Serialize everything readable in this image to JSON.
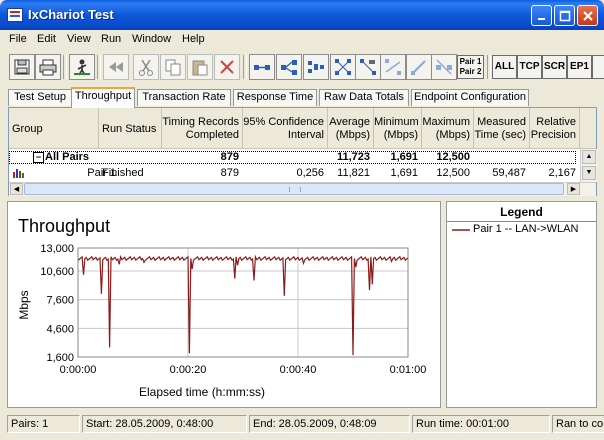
{
  "window": {
    "title": "IxChariot Test"
  },
  "menu": [
    "File",
    "Edit",
    "View",
    "Run",
    "Window",
    "Help"
  ],
  "toolbar": {
    "pair_label_1": "Pair 1",
    "pair_label_2": "Pair 2",
    "all": "ALL",
    "tcp": "TCP",
    "scr": "SCR",
    "ep1": "EP1"
  },
  "tabs": [
    "Test Setup",
    "Throughput",
    "Transaction Rate",
    "Response Time",
    "Raw Data Totals",
    "Endpoint Configuration"
  ],
  "active_tab": "Throughput",
  "table": {
    "headers": [
      {
        "line1": "",
        "line2": "Group"
      },
      {
        "line1": "",
        "line2": "Run Status"
      },
      {
        "line1": "Timing Records",
        "line2": "Completed"
      },
      {
        "line1": "95% Confidence",
        "line2": "Interval"
      },
      {
        "line1": "Average",
        "line2": "(Mbps)"
      },
      {
        "line1": "Minimum",
        "line2": "(Mbps)"
      },
      {
        "line1": "Maximum",
        "line2": "(Mbps)"
      },
      {
        "line1": "Measured",
        "line2": "Time (sec)"
      },
      {
        "line1": "Relative",
        "line2": "Precision"
      }
    ],
    "summary": {
      "group": "All Pairs",
      "records": "879",
      "average": "11,723",
      "minimum": "1,691",
      "maximum": "12,500"
    },
    "rows": [
      {
        "group": "Pair 1",
        "status": "Finished",
        "records": "879",
        "confidence": "0,256",
        "average": "11,821",
        "minimum": "1,691",
        "maximum": "12,500",
        "measured": "59,487",
        "precision": "2,167"
      }
    ]
  },
  "chart": {
    "title": "Throughput",
    "colors": {
      "series": "#8b1a1a",
      "grid": "#c8c8c8"
    }
  },
  "chart_data": {
    "type": "line",
    "title": "Throughput",
    "xlabel": "Elapsed time (h:mm:ss)",
    "ylabel": "Mbps",
    "x_ticks": [
      "0:00:00",
      "0:00:20",
      "0:00:40",
      "0:01:00"
    ],
    "y_ticks": [
      "1,600",
      "4,600",
      "7,600",
      "10,600",
      "13,000"
    ],
    "xlim": [
      0,
      60
    ],
    "ylim": [
      1600,
      13000
    ],
    "series": [
      {
        "name": "Pair 1 -- LAN->WLAN",
        "baseline": 11900,
        "dips": [
          {
            "x": 1.0,
            "y": 10200
          },
          {
            "x": 4.2,
            "y": 8200
          },
          {
            "x": 5.7,
            "y": 2600
          },
          {
            "x": 7.5,
            "y": 11300
          },
          {
            "x": 12.0,
            "y": 11500
          },
          {
            "x": 20.2,
            "y": 2000
          },
          {
            "x": 20.8,
            "y": 10800
          },
          {
            "x": 28.5,
            "y": 9800
          },
          {
            "x": 29.0,
            "y": 11200
          },
          {
            "x": 32.0,
            "y": 9600
          },
          {
            "x": 37.5,
            "y": 8000
          },
          {
            "x": 41.0,
            "y": 11400
          },
          {
            "x": 50.0,
            "y": 1800
          },
          {
            "x": 50.5,
            "y": 11000
          },
          {
            "x": 53.0,
            "y": 8600
          },
          {
            "x": 53.5,
            "y": 9200
          },
          {
            "x": 57.0,
            "y": 11600
          }
        ]
      }
    ]
  },
  "legend": {
    "title": "Legend",
    "entry": "Pair 1 -- LAN->WLAN"
  },
  "statusbar": {
    "pairs": "Pairs: 1",
    "start": "Start: 28.05.2009, 0:48:00",
    "end": "End: 28.05.2009, 0:48:09",
    "run_time": "Run time: 00:01:00",
    "ran_to": "Ran to co"
  }
}
